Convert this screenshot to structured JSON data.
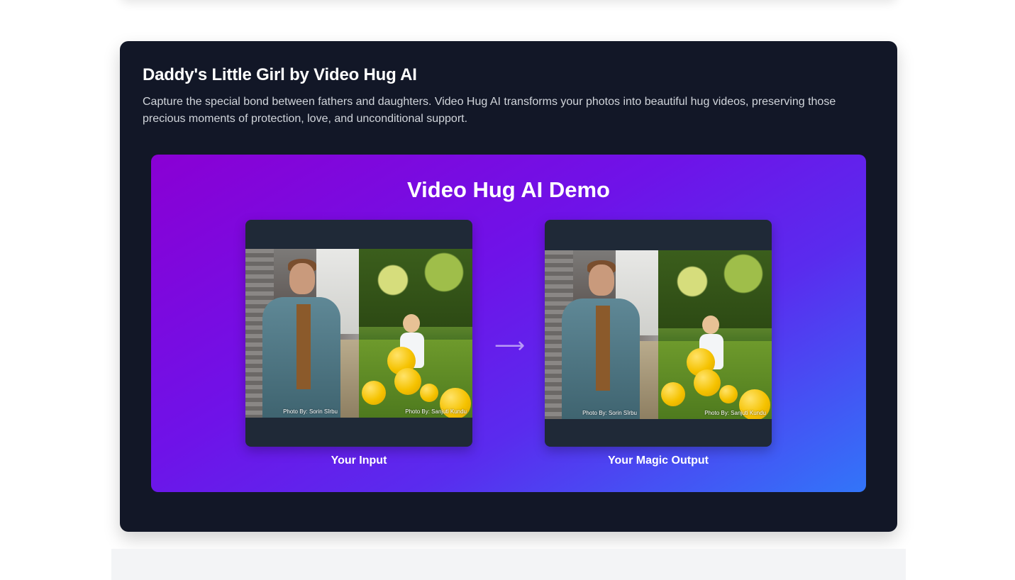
{
  "section": {
    "title": "Daddy's Little Girl by Video Hug AI",
    "description": "Capture the special bond between fathers and daughters. Video Hug AI transforms your photos into beautiful hug videos, preserving those precious moments of protection, love, and unconditional support."
  },
  "demo": {
    "title": "Video Hug AI Demo",
    "arrow_icon": "arrow-right-icon",
    "input": {
      "caption": "Your Input",
      "left_credit": "Photo By: Sorin Sîrbu",
      "right_credit": "Photo By: Sanjuti Kundu"
    },
    "output": {
      "caption": "Your Magic Output",
      "left_credit": "Photo By: Sorin Sîrbu",
      "right_credit": "Photo By: Sanjuti Kundu"
    }
  },
  "colors": {
    "card_bg": "#121727",
    "gradient_start": "#8a00d4",
    "gradient_end": "#3275f9",
    "frame_bg": "#1f2937"
  }
}
